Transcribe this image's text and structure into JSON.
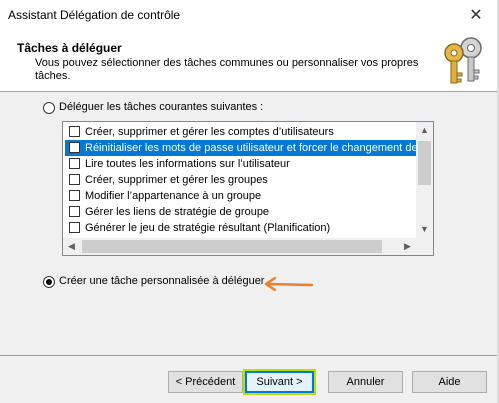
{
  "window": {
    "title": "Assistant Délégation de contrôle",
    "close_glyph": "✕"
  },
  "header": {
    "title": "Tâches à déléguer",
    "subtitle": "Vous pouvez sélectionner des tâches communes ou personnaliser vos propres tâches.",
    "icon": "keys-icon"
  },
  "options": {
    "common": {
      "label": "Déléguer les tâches courantes suivantes :",
      "checked": false
    },
    "custom": {
      "label": "Créer une tâche personnalisée à déléguer",
      "checked": true
    }
  },
  "tasks": [
    {
      "label": "Créer, supprimer et gérer les comptes d’utilisateurs",
      "checked": false,
      "selected": false
    },
    {
      "label": "Réinitialiser les mots de passe utilisateur et forcer le changement de mot de passe",
      "checked": false,
      "selected": true
    },
    {
      "label": "Lire toutes les informations sur l’utilisateur",
      "checked": false,
      "selected": false
    },
    {
      "label": "Créer, supprimer et gérer les groupes",
      "checked": false,
      "selected": false
    },
    {
      "label": "Modifier l’appartenance à un groupe",
      "checked": false,
      "selected": false
    },
    {
      "label": "Gérer les liens de stratégie de groupe",
      "checked": false,
      "selected": false
    },
    {
      "label": "Générer le jeu de stratégie résultant (Planification)",
      "checked": false,
      "selected": false
    }
  ],
  "annotation": {
    "arrow_color": "#f07d28"
  },
  "buttons": {
    "back": "< Précédent",
    "next": "Suivant >",
    "cancel": "Annuler",
    "help": "Aide"
  },
  "colors": {
    "selection": "#0078d7",
    "focus_highlight": "#b8e000"
  }
}
